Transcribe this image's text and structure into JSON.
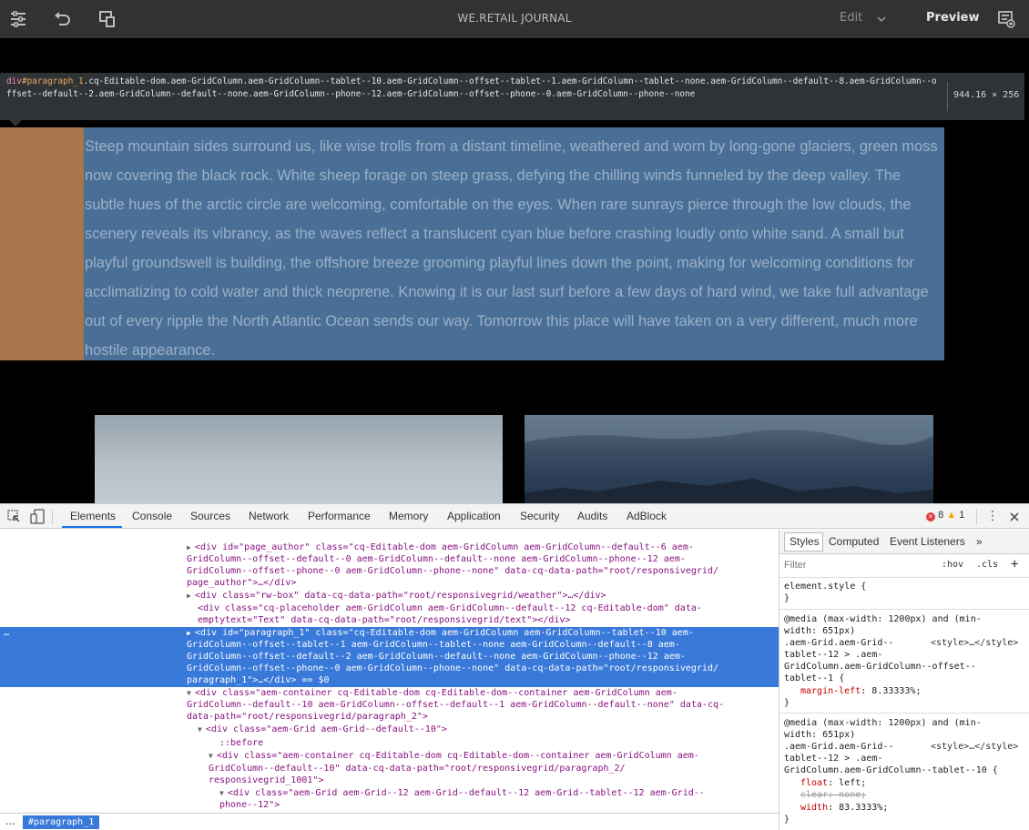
{
  "topbar": {
    "title": "WE.RETAIL JOURNAL",
    "mode_label": "Edit",
    "preview_label": "Preview"
  },
  "tooltip": {
    "tag": "div",
    "id": "#paragraph_1",
    "classes": ".cq-Editable-dom.aem-GridColumn.aem-GridColumn--tablet--10.aem-GridColumn--offset--tablet--1.aem-GridColumn--tablet--none.aem-GridColumn--default--8.aem-GridColumn--offset--default--2.aem-GridColumn--default--none.aem-GridColumn--phone--12.aem-GridColumn--offset--phone--0.aem-GridColumn--phone--none",
    "size": "944.16 × 256"
  },
  "page": {
    "paragraph": "Steep mountain sides surround us, like wise trolls from a distant timeline, weathered and worn by long-gone glaciers, green moss now covering the black rock. White sheep forage on steep grass, defying the chilling winds funneled by the deep valley. The subtle hues of the arctic circle are welcoming, comfortable on the eyes. When rare sunrays pierce through the low clouds, the scenery reveals its vibrancy, as the waves reflect a translucent cyan blue before crashing loudly onto white sand. A small but playful groundswell is building, the offshore breeze grooming playful lines down the point, making for welcoming conditions for acclimatizing to cold water and thick neoprene. Knowing it is our last surf before a few days of hard wind, we take full advantage out of every ripple the North Atlantic Ocean sends our way. Tomorrow this place will have taken on a very different, much more hostile appearance."
  },
  "devtools": {
    "tabs": [
      "Elements",
      "Console",
      "Sources",
      "Network",
      "Performance",
      "Memory",
      "Application",
      "Security",
      "Audits",
      "AdBlock"
    ],
    "error_count": "8",
    "warning_count": "1",
    "dom_lines": [
      [
        "",
        "",
        "page_author_image\">…</div>"
      ],
      [
        "▶",
        "<div id=\"page_author\" class=\"cq-Editable-dom aem-GridColumn aem-GridColumn--default--6 aem-",
        ""
      ],
      [
        "",
        "GridColumn--offset--default--0 aem-GridColumn--default--none aem-GridColumn--phone--12 aem-",
        ""
      ],
      [
        "",
        "GridColumn--offset--phone--0 aem-GridColumn--phone--none\" data-cq-data-path=\"root/responsivegrid/",
        ""
      ],
      [
        "",
        "page_author\">…</div>",
        ""
      ],
      [
        "▶",
        "<div class=\"rw-box\" data-cq-data-path=\"root/responsivegrid/weather\">…</div>",
        ""
      ],
      [
        "",
        "<div class=\"cq-placeholder aem-GridColumn aem-GridColumn--default--12 cq-Editable-dom\" data-",
        ""
      ],
      [
        "",
        "emptytext=\"Text\" data-cq-data-path=\"root/responsivegrid/text\"></div>",
        ""
      ],
      [
        "▶",
        "<div id=\"paragraph_1\" class=\"cq-Editable-dom aem-GridColumn aem-GridColumn--tablet--10 aem-",
        "hl"
      ],
      [
        "",
        "GridColumn--offset--tablet--1 aem-GridColumn--tablet--none aem-GridColumn--default--8 aem-",
        "hl"
      ],
      [
        "",
        "GridColumn--offset--default--2 aem-GridColumn--default--none aem-GridColumn--phone--12 aem-",
        "hl"
      ],
      [
        "",
        "GridColumn--offset--phone--0 aem-GridColumn--phone--none\" data-cq-data-path=\"root/responsivegrid/",
        "hl"
      ],
      [
        "",
        "paragraph_1\">…</div> == $0",
        "hl"
      ],
      [
        "▼",
        "<div class=\"aem-container cq-Editable-dom cq-Editable-dom--container aem-GridColumn aem-",
        ""
      ],
      [
        "",
        "GridColumn--default--10 aem-GridColumn--offset--default--1 aem-GridColumn--default--none\" data-cq-",
        ""
      ],
      [
        "",
        "data-path=\"root/responsivegrid/paragraph_2\">",
        ""
      ],
      [
        "▼",
        "<div class=\"aem-Grid aem-Grid--default--10\">",
        ""
      ],
      [
        "",
        "::before",
        ""
      ],
      [
        "▼",
        "<div class=\"aem-container cq-Editable-dom cq-Editable-dom--container aem-GridColumn aem-",
        ""
      ],
      [
        "",
        "GridColumn--default--10\" data-cq-data-path=\"root/responsivegrid/paragraph_2/",
        ""
      ],
      [
        "",
        "responsivegrid_1001\">",
        ""
      ],
      [
        "▼",
        "<div class=\"aem-Grid aem-Grid--12 aem-Grid--default--12 aem-Grid--tablet--12 aem-Grid--",
        ""
      ],
      [
        "",
        "phone--12\">",
        ""
      ]
    ],
    "breadcrumb": "#paragraph_1",
    "styles": {
      "tabs": [
        "Styles",
        "Computed",
        "Event Listeners"
      ],
      "filter_placeholder": "Filter",
      "hov": ":hov",
      "cls": ".cls",
      "element_style": "element.style {",
      "rule1_media": "@media (max-width: 1200px) and (min-",
      "rule1_media2": "width: 651px)",
      "rule1_sel1": ".aem-Grid.aem-Grid--",
      "rule1_src": "<style>…</style>",
      "rule1_sel2": "tablet--12 > .aem-",
      "rule1_sel3": "GridColumn.aem-GridColumn--offset--",
      "rule1_sel4": "tablet--1 {",
      "rule1_prop": "margin-left",
      "rule1_val": "8.33333%;",
      "rule2_media": "@media (max-width: 1200px) and (min-",
      "rule2_media2": "width: 651px)",
      "rule2_sel1": ".aem-Grid.aem-Grid--",
      "rule2_src": "<style>…</style>",
      "rule2_sel2": "tablet--12 > .aem-",
      "rule2_sel3": "GridColumn.aem-GridColumn--tablet--10 {",
      "rule2_p1": "float",
      "rule2_v1": "left;",
      "rule2_p2": "clear",
      "rule2_v2": "none;",
      "rule2_p3": "width",
      "rule2_v3": "83.3333%;"
    }
  }
}
